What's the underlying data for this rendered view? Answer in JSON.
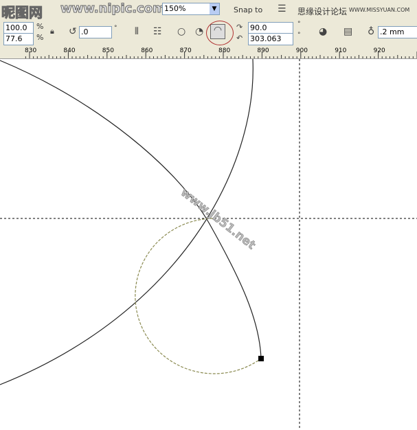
{
  "toolbar1": {
    "zoom": "150%",
    "snap_to": "Snap to",
    "logo_left": "昵图网",
    "logo_mid": "www.nipic.com",
    "site_name": "思缘设计论坛",
    "site_url": "WWW.MISSYUAN.COM"
  },
  "toolbar2": {
    "scale_x": "100.0",
    "scale_y": "77.6",
    "pct": "%",
    "rotation": ".0",
    "deg": "°",
    "start_angle": "90.0",
    "end_angle": "303.063",
    "outline_width": ".2 mm"
  },
  "ruler": {
    "ticks": [
      "830",
      "840",
      "850",
      "860",
      "870",
      "880",
      "890",
      "900",
      "910",
      "920"
    ]
  },
  "watermark": "www.jb51.net",
  "colors": {
    "accent_circle": "#b03030",
    "dashed_arc": "#8a8a50"
  }
}
